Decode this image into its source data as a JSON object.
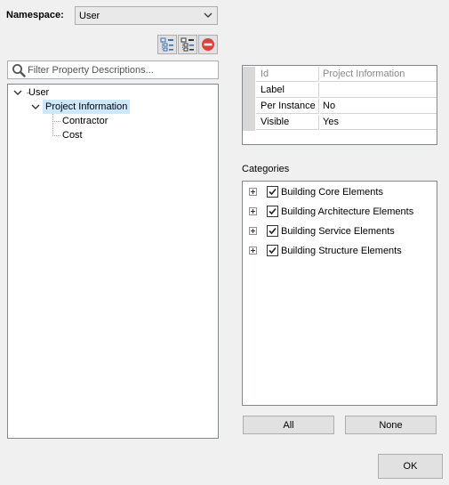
{
  "namespace": {
    "label": "Namespace:",
    "selected": "User"
  },
  "toolbar": {
    "buttons": [
      {
        "icon": "expand-all-icon"
      },
      {
        "icon": "collapse-all-icon"
      },
      {
        "icon": "remove-red-icon",
        "color": "#e0403a"
      }
    ]
  },
  "filter": {
    "placeholder": "Filter Property Descriptions...",
    "value": ""
  },
  "tree": {
    "root": "User",
    "child": "Project Information",
    "leaves": [
      "Contractor",
      "Cost"
    ],
    "selection_color": "#cce8ff"
  },
  "properties": {
    "header": {
      "key": "Id",
      "value": "Project Information"
    },
    "rows": [
      {
        "key": "Label",
        "value": ""
      },
      {
        "key": "Per Instance",
        "value": "No"
      },
      {
        "key": "Visible",
        "value": "Yes"
      }
    ]
  },
  "categories": {
    "label": "Categories",
    "items": [
      {
        "label": "Building Core Elements",
        "checked": true
      },
      {
        "label": "Building Architecture Elements",
        "checked": true
      },
      {
        "label": "Building Service Elements",
        "checked": true
      },
      {
        "label": "Building Structure Elements",
        "checked": true
      }
    ]
  },
  "buttons": {
    "all": "All",
    "none": "None",
    "ok": "OK"
  }
}
